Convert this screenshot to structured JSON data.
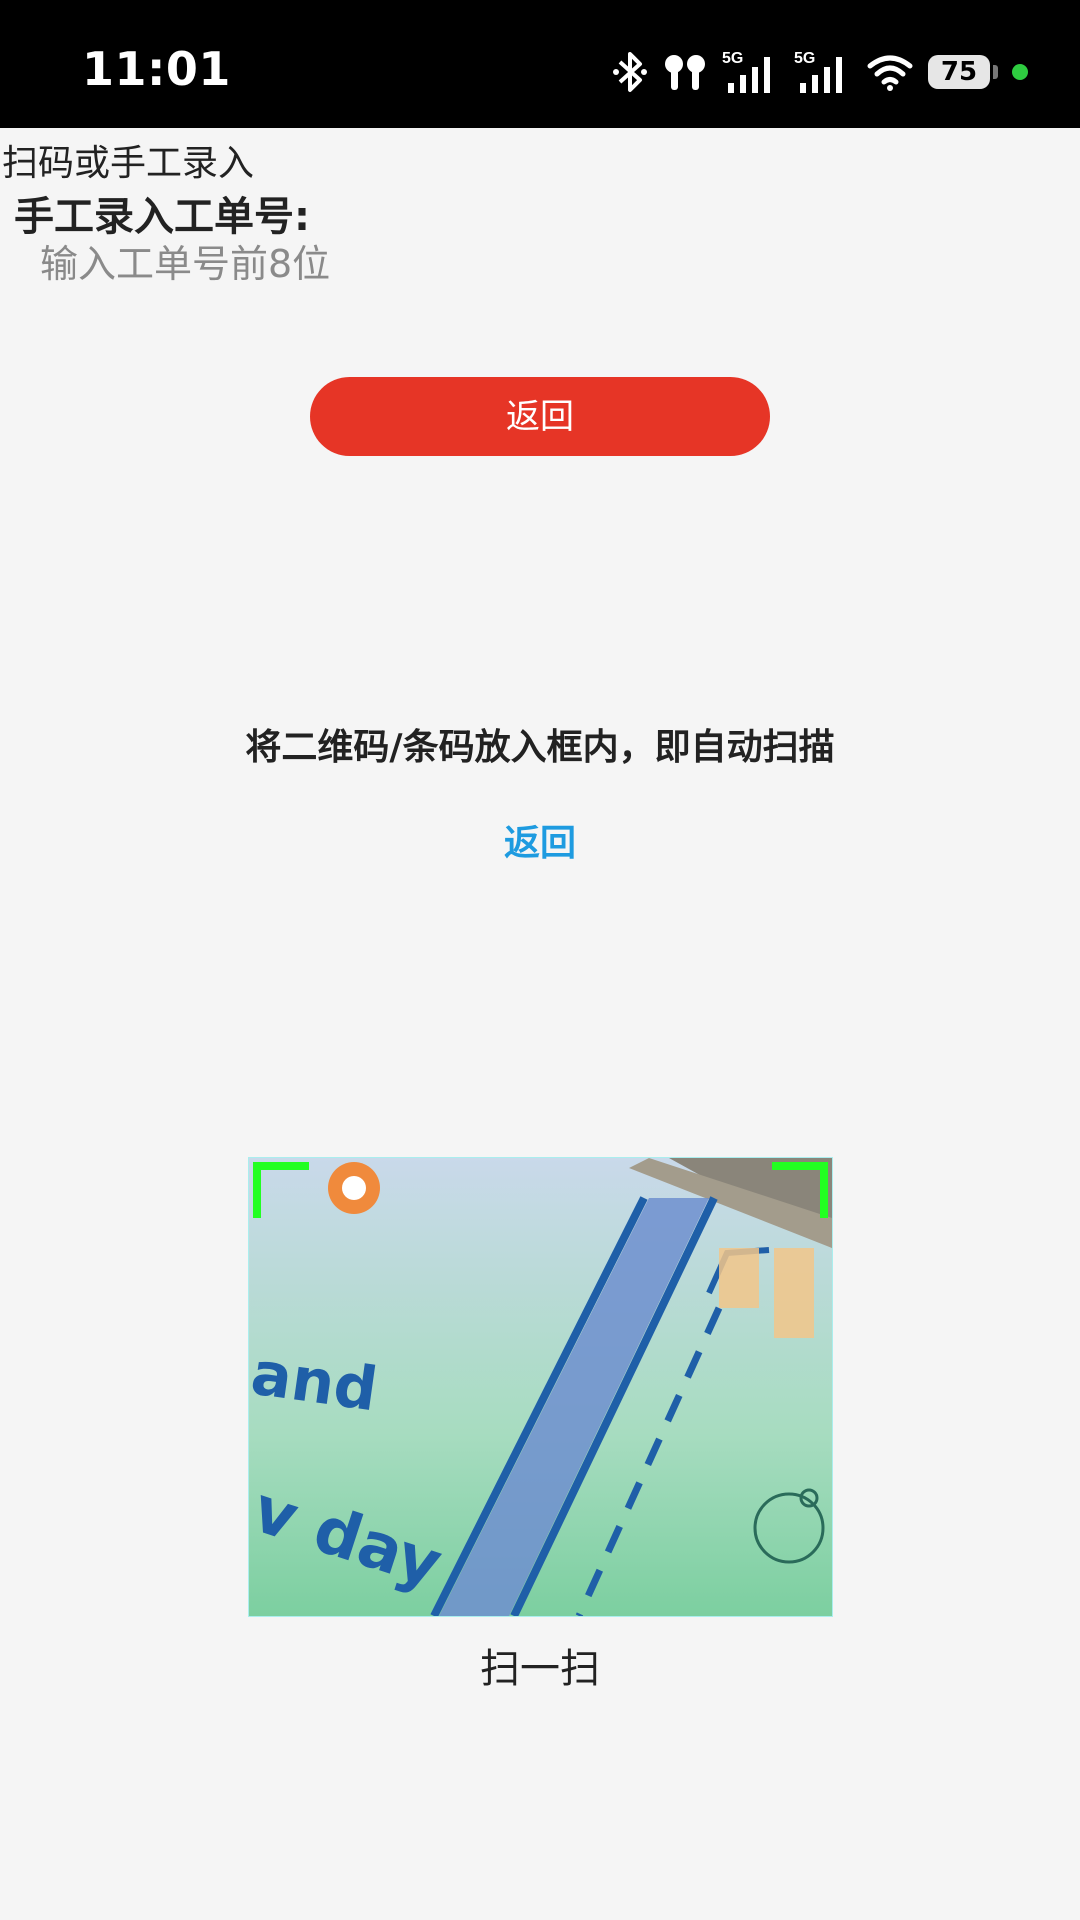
{
  "status_bar": {
    "time": "11:01",
    "battery": "75",
    "network_1": "5G",
    "network_2": "5G"
  },
  "page": {
    "title": "扫码或手工录入",
    "manual_label": "手工录入工单号:",
    "order_input": {
      "value": "",
      "placeholder": "输入工单号前8位"
    },
    "back_button": "返回"
  },
  "scanner": {
    "hint": "将二维码/条码放入框内，即自动扫描",
    "back_link": "返回",
    "scan_label": "扫一扫"
  },
  "colors": {
    "accent_red": "#e63526",
    "link_blue": "#1e9be0",
    "frame_green": "#22ff22"
  }
}
